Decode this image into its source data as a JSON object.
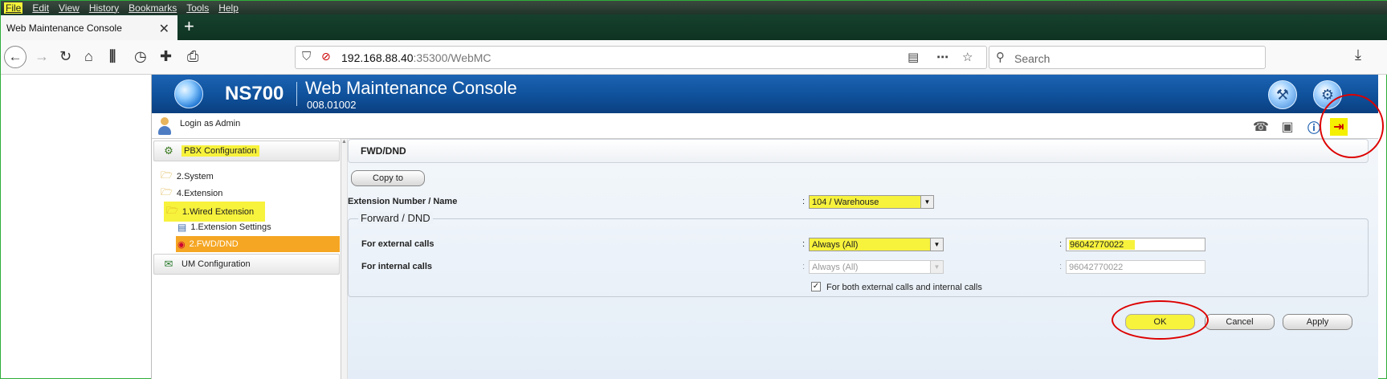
{
  "browser": {
    "menu": [
      "File",
      "Edit",
      "View",
      "History",
      "Bookmarks",
      "Tools",
      "Help"
    ],
    "tab_title": "Web Maintenance Console",
    "url_host": "192.168.88.40",
    "url_rest": ":35300/WebMC",
    "search_placeholder": "Search"
  },
  "app": {
    "brand": "NS700",
    "title": "Web Maintenance Console",
    "version": "008.01002",
    "login_text": "Login as Admin"
  },
  "sidebar": {
    "pbx_section": "PBX Configuration",
    "items": [
      {
        "label": "2.System"
      },
      {
        "label": "4.Extension"
      },
      {
        "label": "1.Wired Extension"
      },
      {
        "label": "1.Extension Settings"
      },
      {
        "label": "2.FWD/DND"
      }
    ],
    "um_section": "UM Configuration"
  },
  "main": {
    "header": "FWD/DND",
    "copy_to_label": "Copy to",
    "ext_label": "Extension Number / Name",
    "ext_value": "104 / Warehouse",
    "group_title": "Forward / DND",
    "external_label": "For external calls",
    "external_mode": "Always (All)",
    "external_number": "96042770022",
    "internal_label": "For internal calls",
    "internal_mode": "Always (All)",
    "internal_number": "96042770022",
    "both_label": "For both external calls and internal calls",
    "both_checked": "✓",
    "ok_label": "OK",
    "cancel_label": "Cancel",
    "apply_label": "Apply"
  },
  "colors": {
    "highlight": "#f7f23c",
    "annotation": "#dd0000",
    "selected_item": "#f5a623",
    "banner": "#0e4f98"
  }
}
